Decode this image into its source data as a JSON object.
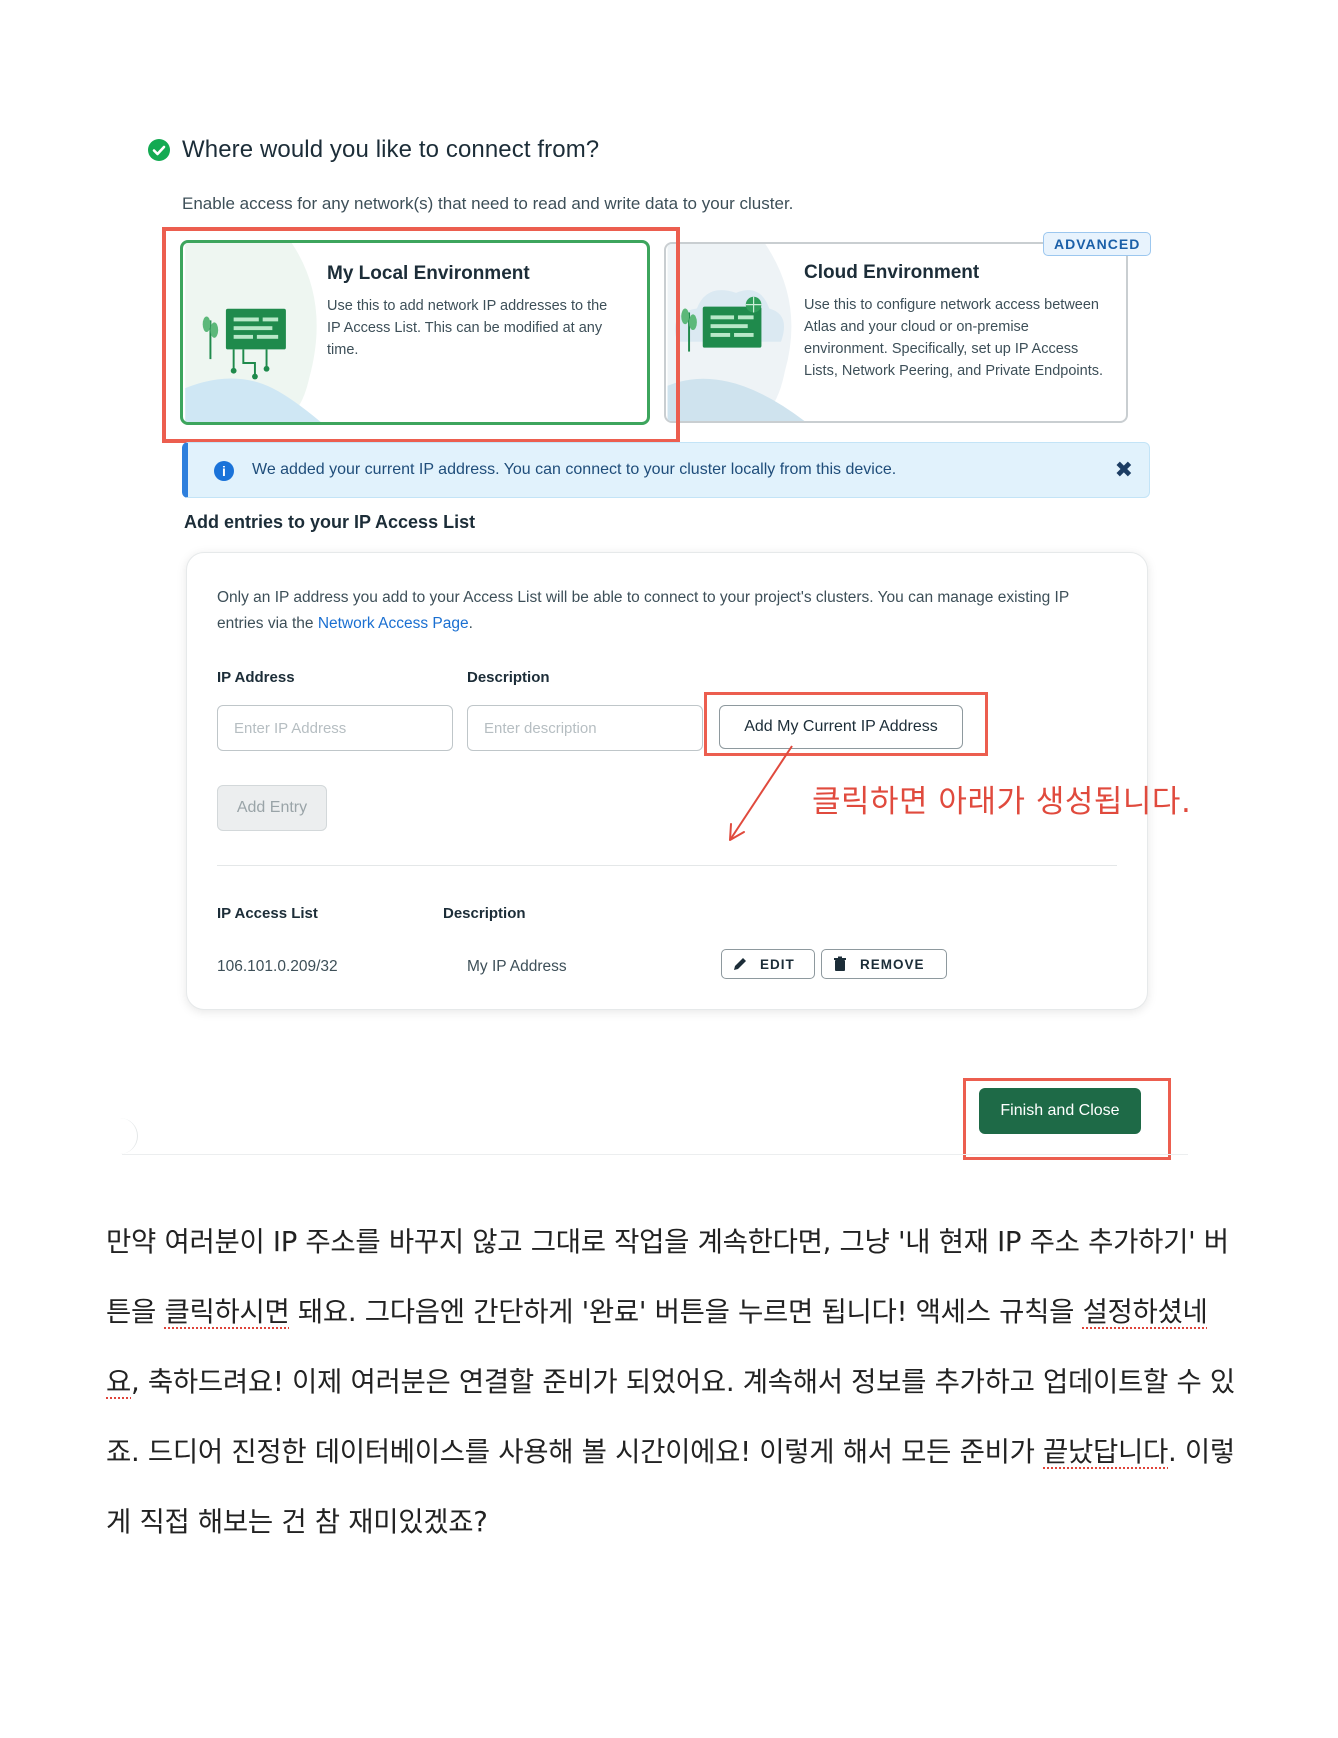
{
  "header": {
    "title": "Where would you like to connect from?",
    "subtitle": "Enable access for any network(s) that need to read and write data to your cluster."
  },
  "environments": {
    "local": {
      "title": "My Local Environment",
      "description": "Use this to add network IP addresses to the IP Access List. This can be modified at any time."
    },
    "cloud": {
      "title": "Cloud Environment",
      "description": "Use this to configure network access between Atlas and your cloud or on-premise environment. Specifically, set up IP Access Lists, Network Peering, and Private Endpoints.",
      "badge": "ADVANCED"
    }
  },
  "banner": {
    "text": "We added your current IP address. You can connect to your cluster locally from this device.",
    "close": "✖"
  },
  "access_list": {
    "heading": "Add entries to your IP Access List",
    "note_prefix": "Only an IP address you add to your Access List will be able to connect to your project's clusters. You can manage existing IP entries via the ",
    "note_link": "Network Access Page",
    "note_suffix": ".",
    "ip_label": "IP Address",
    "ip_placeholder": "Enter IP Address",
    "desc_label": "Description",
    "desc_placeholder": "Enter description",
    "add_current_ip": "Add My Current IP Address",
    "add_entry": "Add Entry",
    "table_headers": {
      "ip": "IP Access List",
      "description": "Description"
    },
    "rows": [
      {
        "ip": "106.101.0.209/32",
        "description": "My IP Address",
        "edit": "EDIT",
        "remove": "REMOVE"
      }
    ]
  },
  "annotation": {
    "text": "클릭하면 아래가 생성됩니다."
  },
  "footer": {
    "finish": "Finish and Close"
  },
  "body": {
    "p1": "만약 여러분이 IP 주소를 바꾸지 않고 그대로 작업을 계속한다면, 그냥 '내 현재 IP 주소 추가하기' 버튼을 ",
    "s1": "클릭하시면",
    "p2": " 돼요. 그다음엔 간단하게 '완료' 버튼을 누르면 됩니다! 액세스 규칙을 ",
    "s2": "설정하셨네요",
    "p3": ", 축하드려요! 이제 여러분은 연결할 준비가 되었어요. 계속해서 정보를 추가하고 업데이트할 수 있죠. 드디어 진정한 데이터베이스를 사용해 볼 시간이에요! 이렇게 해서 모든 준비가 ",
    "s3": "끝났답니다",
    "p4": ". 이렇게 직접 해보는 건 참 재미있겠죠?"
  },
  "colors": {
    "accent_green": "#13aa52",
    "finish_green": "#1e6a47",
    "highlight_red": "#ec5e4f",
    "link_blue": "#1a6fd1"
  }
}
